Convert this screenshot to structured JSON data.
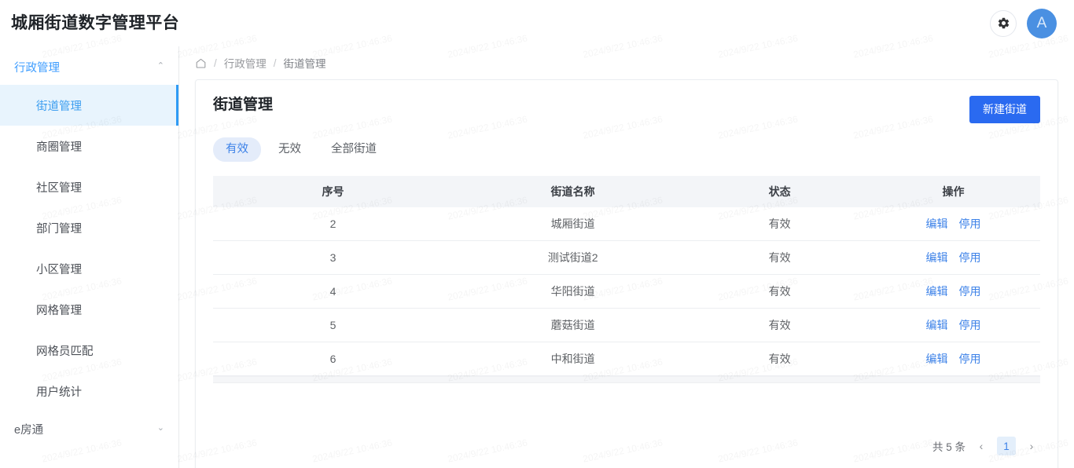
{
  "header": {
    "app_title": "城厢街道数字管理平台",
    "gear_icon": "gear-icon",
    "avatar_initial": "A",
    "avatar_color": "#4a90e2"
  },
  "sidebar": {
    "groups": [
      {
        "label": "行政管理",
        "expanded": true,
        "caret": "⌃",
        "items": [
          {
            "label": "街道管理",
            "active": true
          },
          {
            "label": "商圈管理",
            "active": false
          },
          {
            "label": "社区管理",
            "active": false
          },
          {
            "label": "部门管理",
            "active": false
          },
          {
            "label": "小区管理",
            "active": false
          },
          {
            "label": "网格管理",
            "active": false
          },
          {
            "label": "网格员匹配",
            "active": false
          },
          {
            "label": "用户统计",
            "active": false
          }
        ]
      },
      {
        "label": "e房通",
        "expanded": false,
        "caret": "⌄",
        "items": []
      }
    ]
  },
  "breadcrumb": {
    "home_icon": "home-icon",
    "separator": "/",
    "items": [
      {
        "label": "行政管理",
        "current": false
      },
      {
        "label": "街道管理",
        "current": true
      }
    ]
  },
  "main": {
    "page_title": "街道管理",
    "new_button_label": "新建街道",
    "tabs": [
      {
        "label": "有效",
        "active": true
      },
      {
        "label": "无效",
        "active": false
      },
      {
        "label": "全部街道",
        "active": false
      }
    ],
    "table": {
      "columns": [
        "序号",
        "街道名称",
        "状态",
        "操作"
      ],
      "rows": [
        {
          "序号": "2",
          "街道名称": "城厢街道",
          "状态": "有效",
          "操作": [
            "编辑",
            "停用"
          ]
        },
        {
          "序号": "3",
          "街道名称": "测试街道2",
          "状态": "有效",
          "操作": [
            "编辑",
            "停用"
          ]
        },
        {
          "序号": "4",
          "街道名称": "华阳街道",
          "状态": "有效",
          "操作": [
            "编辑",
            "停用"
          ]
        },
        {
          "序号": "5",
          "街道名称": "蘑菇街道",
          "状态": "有效",
          "操作": [
            "编辑",
            "停用"
          ]
        },
        {
          "序号": "6",
          "街道名称": "中和街道",
          "状态": "有效",
          "操作": [
            "编辑",
            "停用"
          ]
        }
      ]
    },
    "pagination": {
      "total_text": "共 5 条",
      "prev_icon": "chevron-left-icon",
      "next_icon": "chevron-right-icon",
      "pages": [
        "1"
      ],
      "current_page": "1"
    }
  },
  "watermark": {
    "text": "2024/9/22 10:46:36",
    "color": "#00000010"
  },
  "theme": {
    "primary": "#2a6af0",
    "link": "#3d82e8",
    "active_menu_bg": "#e8f4fd",
    "active_menu_border": "#2f9bf5"
  }
}
